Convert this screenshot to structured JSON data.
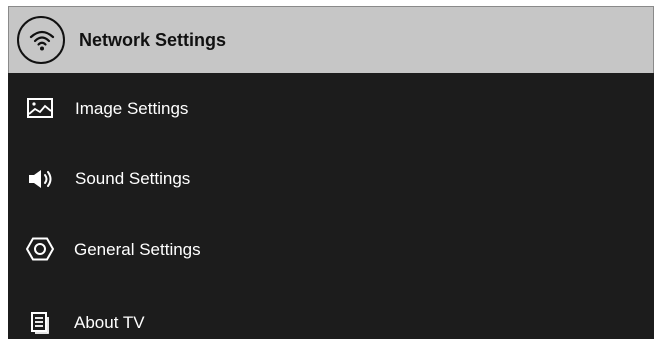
{
  "menu": {
    "items": [
      {
        "label": "Network Settings",
        "icon": "wifi-icon",
        "selected": true
      },
      {
        "label": "Image Settings",
        "icon": "image-icon",
        "selected": false
      },
      {
        "label": "Sound Settings",
        "icon": "speaker-icon",
        "selected": false
      },
      {
        "label": "General Settings",
        "icon": "hexagon-icon",
        "selected": false
      },
      {
        "label": "About TV",
        "icon": "document-icon",
        "selected": false
      }
    ]
  },
  "colors": {
    "background": "#1c1c1c",
    "selected_background": "#c6c6c6",
    "text": "#ffffff",
    "selected_text": "#111111"
  }
}
